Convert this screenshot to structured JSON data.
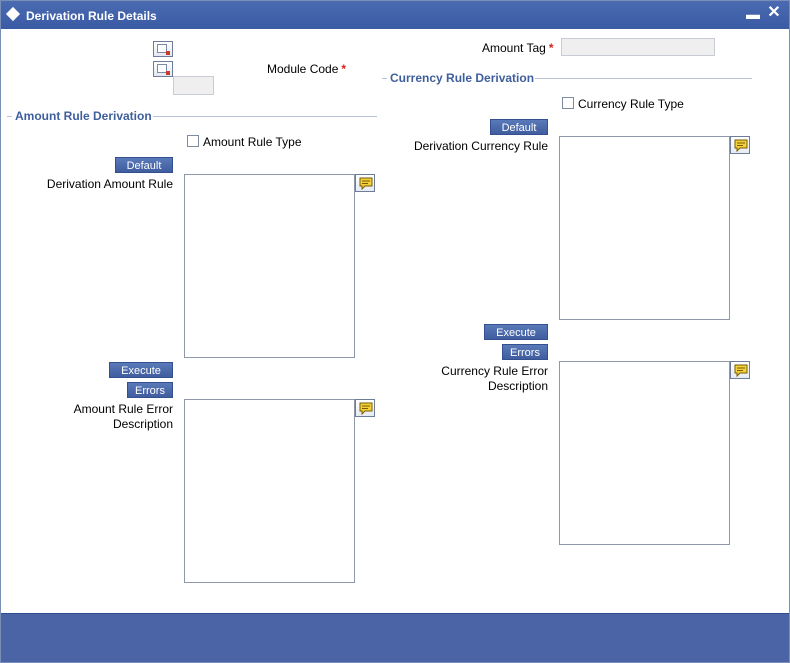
{
  "window": {
    "title": "Derivation Rule Details",
    "minimize_label": "▬",
    "close_label": "✕"
  },
  "header": {
    "amount_tag_label": "Amount Tag",
    "module_code_label": "Module Code",
    "required_mark": "*"
  },
  "amount_section": {
    "title": "Amount Rule Derivation",
    "rule_type_label": "Amount Rule Type",
    "default_label": "Default",
    "derivation_rule_label": "Derivation Amount Rule",
    "execute_label": "Execute",
    "errors_label": "Errors",
    "error_desc_line1": "Amount Rule Error",
    "error_desc_line2": "Description"
  },
  "currency_section": {
    "title": "Currency Rule Derivation",
    "rule_type_label": "Currency Rule Type",
    "default_label": "Default",
    "derivation_rule_label": "Derivation Currency Rule",
    "execute_label": "Execute",
    "errors_label": "Errors",
    "error_desc_line1": "Currency Rule Error",
    "error_desc_line2": "Description"
  },
  "icons": {
    "title": "diamond-icon",
    "comment": "comment-bubble-icon",
    "doc": "document-icon"
  },
  "colors": {
    "titlebar": "#3a5aa4",
    "section_header": "#3f5f9c",
    "button": "#3f5d9f",
    "required": "#d42020",
    "footer": "#4a64a5"
  }
}
